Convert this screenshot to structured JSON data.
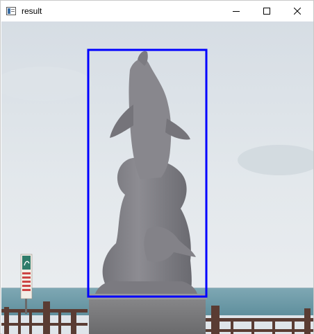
{
  "window": {
    "title": "result",
    "app_icon": "image-window-icon",
    "controls": {
      "minimize_icon": "minimize-icon",
      "maximize_icon": "maximize-icon",
      "close_icon": "close-icon"
    }
  },
  "image": {
    "subject_icon": "dolphin-statue",
    "detection_box_color": "#0000ff",
    "sign": {
      "lines": [
        "",
        "",
        ""
      ]
    }
  }
}
